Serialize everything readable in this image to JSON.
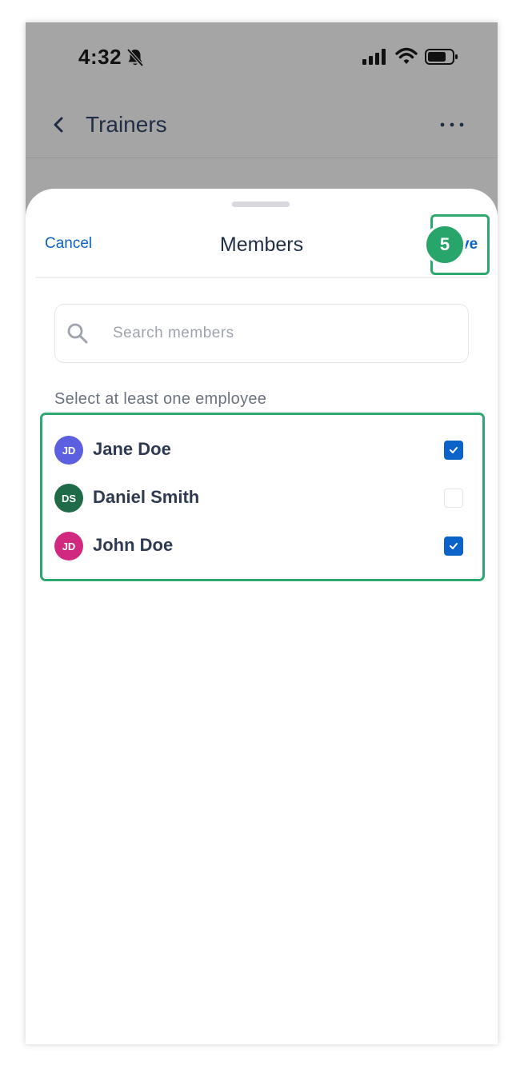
{
  "status_bar": {
    "time": "4:32",
    "icons": [
      "bell-slash-icon",
      "signal-icon",
      "wifi-icon",
      "battery-icon"
    ]
  },
  "nav": {
    "title": "Trainers",
    "back_icon": "chevron-left-icon",
    "more_icon": "ellipsis-icon"
  },
  "sheet": {
    "cancel_label": "Cancel",
    "title": "Members",
    "save_label": "Save",
    "step_badge": "5"
  },
  "search": {
    "placeholder": "Search members",
    "value": ""
  },
  "hint": "Select at least one employee",
  "members": [
    {
      "initials": "JD",
      "name": "Jane Doe",
      "avatar_color": "#5b5fe0",
      "checked": true
    },
    {
      "initials": "DS",
      "name": "Daniel Smith",
      "avatar_color": "#1f6b48",
      "checked": false
    },
    {
      "initials": "JD",
      "name": "John Doe",
      "avatar_color": "#d1297f",
      "checked": true
    }
  ],
  "colors": {
    "accent": "#0b63c9",
    "highlight": "#2fa86f",
    "badge": "#27a56a",
    "overlay": "#a5a5a5",
    "title_text": "#1f2e44"
  }
}
